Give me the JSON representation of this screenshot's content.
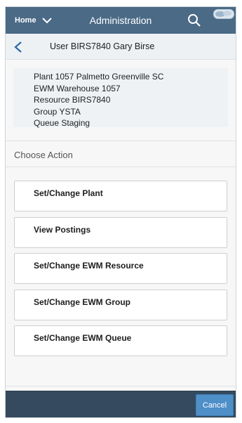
{
  "shell": {
    "home_label": "Home",
    "title": "Administration",
    "icons": [
      "chevron-down-icon",
      "search-icon",
      "company-logo"
    ]
  },
  "subheader": {
    "title": "User BIRS7840 Gary Birse",
    "back_icon": "back-arrow-icon"
  },
  "info": {
    "lines": [
      "Plant 1057 Palmetto Greenville SC",
      "EWM Warehouse 1057",
      "Resource BIRS7840",
      "Group YSTA",
      "Queue Staging"
    ]
  },
  "section_title": "Choose Action",
  "actions": [
    "Set/Change Plant",
    "View Postings",
    "Set/Change EWM Resource",
    "Set/Change EWM Group",
    "Set/Change EWM Queue"
  ],
  "footer": {
    "cancel_label": "Cancel"
  },
  "colors": {
    "shell_bg": "#4a6a86",
    "footer_bg": "#354a5e",
    "button_accent": "#4e8fc8"
  }
}
